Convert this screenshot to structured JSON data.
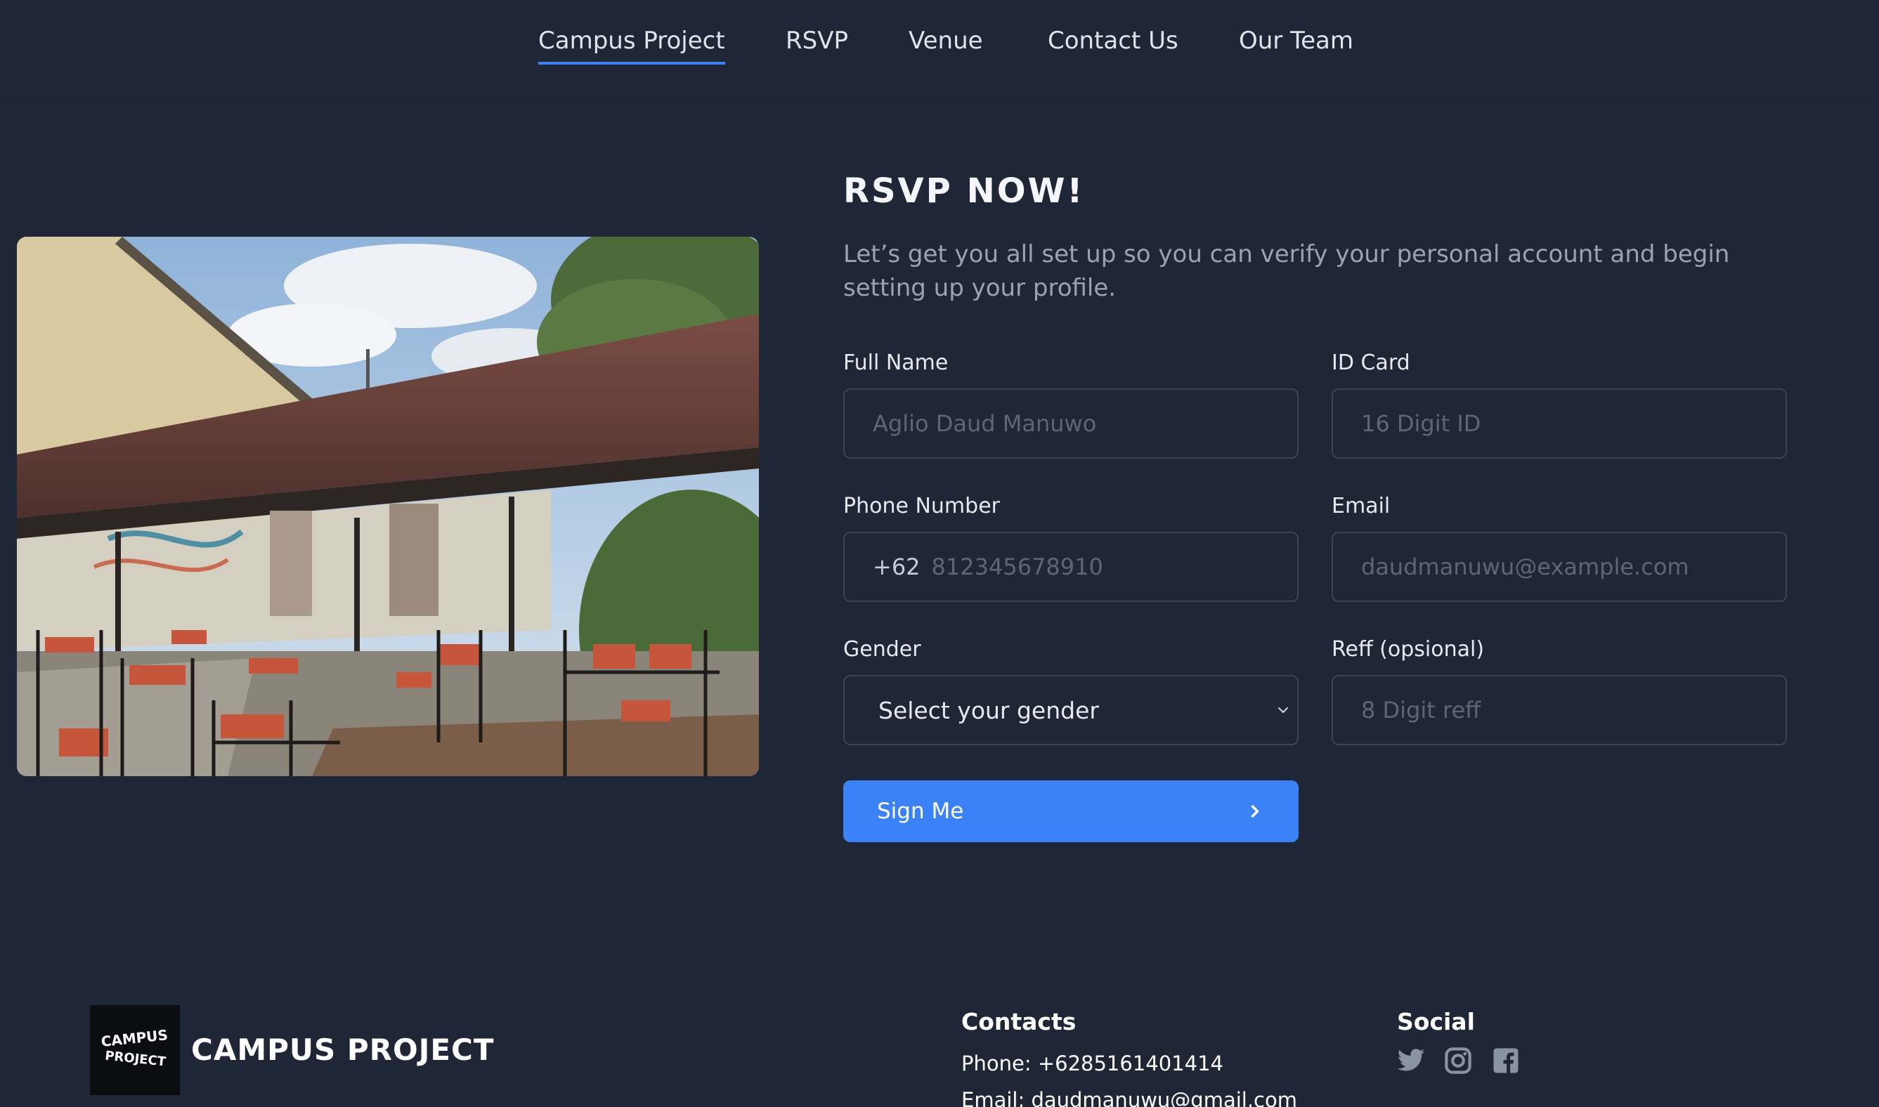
{
  "nav": {
    "items": [
      {
        "label": "Campus Project",
        "active": true
      },
      {
        "label": "RSVP",
        "active": false
      },
      {
        "label": "Venue",
        "active": false
      },
      {
        "label": "Contact Us",
        "active": false
      },
      {
        "label": "Our Team",
        "active": false
      }
    ]
  },
  "form": {
    "title": "RSVP NOW!",
    "description": "Let’s get you all set up so you can verify your personal account and begin setting up your profile.",
    "full_name": {
      "label": "Full Name",
      "placeholder": "Aglio Daud Manuwo",
      "value": ""
    },
    "id_card": {
      "label": "ID Card",
      "placeholder": "16 Digit ID",
      "value": ""
    },
    "phone": {
      "label": "Phone Number",
      "prefix": "+62",
      "placeholder": "812345678910",
      "value": ""
    },
    "email": {
      "label": "Email",
      "placeholder": "daudmanuwu@example.com",
      "value": ""
    },
    "gender": {
      "label": "Gender",
      "selected": "Select your gender"
    },
    "reff": {
      "label": "Reff (opsional)",
      "placeholder": "8 Digit reff",
      "value": ""
    },
    "submit_label": "Sign Me"
  },
  "footer": {
    "brand": "CAMPUS PROJECT",
    "logo_text": "CAMPUS PROJECT",
    "contacts_heading": "Contacts",
    "phone": "Phone: +6285161401414",
    "email": "Email: daudmanuwu@gmail.com",
    "social_heading": "Social",
    "social_icons": [
      "twitter-icon",
      "instagram-icon",
      "facebook-icon"
    ]
  },
  "colors": {
    "background": "#1f2737",
    "accent": "#3b82f6",
    "muted_text": "#9aa3b2"
  }
}
